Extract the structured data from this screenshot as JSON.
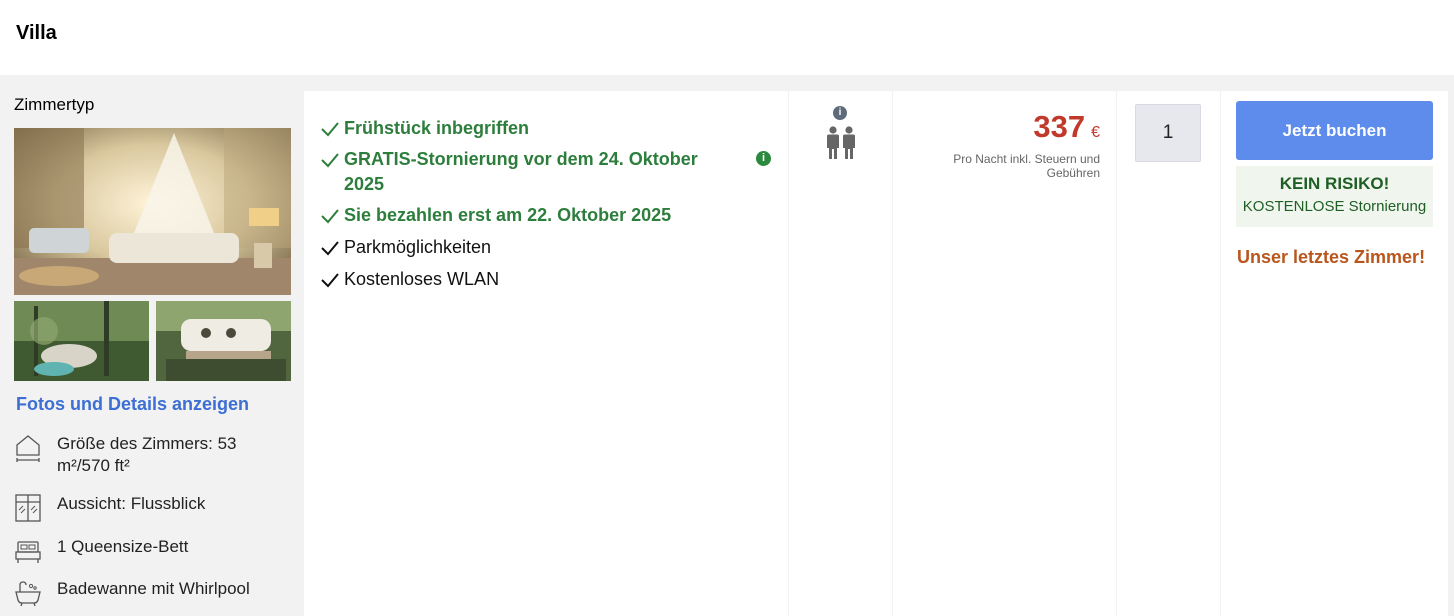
{
  "header": {
    "title": "Villa"
  },
  "room": {
    "heading": "Zimmertyp",
    "photos_link": "Fotos und Details anzeigen",
    "amenities": [
      {
        "icon": "room-size-icon",
        "text": "Größe des Zimmers: 53 m²/570 ft²"
      },
      {
        "icon": "window-view-icon",
        "text": "Aussicht: Flussblick"
      },
      {
        "icon": "bed-icon",
        "text": "1 Queensize-Bett"
      },
      {
        "icon": "bathtub-icon",
        "text": "Badewanne mit Whirlpool"
      }
    ]
  },
  "features": [
    {
      "text": "Frühstück inbegriffen",
      "style": "green"
    },
    {
      "text": "GRATIS-Stornierung vor dem 24. Oktober 2025",
      "style": "green"
    },
    {
      "text": "Sie bezahlen erst am 22. Oktober 2025",
      "style": "green"
    },
    {
      "text": "Parkmöglichkeiten",
      "style": "black"
    },
    {
      "text": "Kostenloses WLAN",
      "style": "black"
    }
  ],
  "occupancy": {
    "info_glyph": "i",
    "icon": "two-persons-icon"
  },
  "price": {
    "amount": "337",
    "currency": "€",
    "note": "Pro Nacht inkl. Steuern und Gebühren"
  },
  "quantity": {
    "value": "1"
  },
  "booking": {
    "button_label": "Jetzt buchen",
    "norisk_title": "KEIN RISIKO!",
    "norisk_subtitle": "KOSTENLOSE Stornierung",
    "last_room": "Unser letztes Zimmer!"
  },
  "colors": {
    "feature_green": "#2d7e3c",
    "price_red": "#c0392b",
    "button_blue": "#5e8cec",
    "link_blue": "#3c6ed4",
    "last_room_orange": "#b8561c"
  }
}
